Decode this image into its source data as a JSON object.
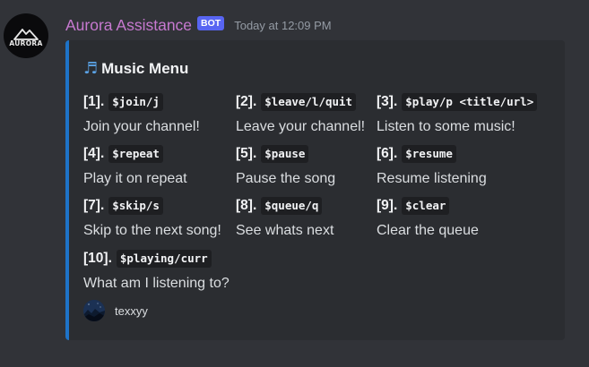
{
  "message": {
    "author": "Aurora Assistance",
    "badge": "BOT",
    "timestamp": "Today at 12:09 PM",
    "avatar_text": "AURORA"
  },
  "embed": {
    "accent_color": "#1e73c8",
    "title_icon": "musical-notes-icon",
    "title": "Music Menu",
    "commands": [
      {
        "num": "[1].",
        "code": "$join/j",
        "desc": "Join your channel!"
      },
      {
        "num": "[2].",
        "code": "$leave/l/quit",
        "desc": "Leave your channel!"
      },
      {
        "num": "[3].",
        "code": "$play/p <title/url>",
        "desc": "Listen to some music!"
      },
      {
        "num": "[4].",
        "code": "$repeat",
        "desc": "Play it on repeat"
      },
      {
        "num": "[5].",
        "code": "$pause",
        "desc": "Pause the song"
      },
      {
        "num": "[6].",
        "code": "$resume",
        "desc": "Resume listening"
      },
      {
        "num": "[7].",
        "code": "$skip/s",
        "desc": "Skip to the next song!"
      },
      {
        "num": "[8].",
        "code": "$queue/q",
        "desc": "See whats next"
      },
      {
        "num": "[9].",
        "code": "$clear",
        "desc": "Clear the queue"
      },
      {
        "num": "[10].",
        "code": "$playing/curr",
        "desc": "What am I listening to?"
      }
    ],
    "footer": {
      "text": "texxyy"
    }
  }
}
